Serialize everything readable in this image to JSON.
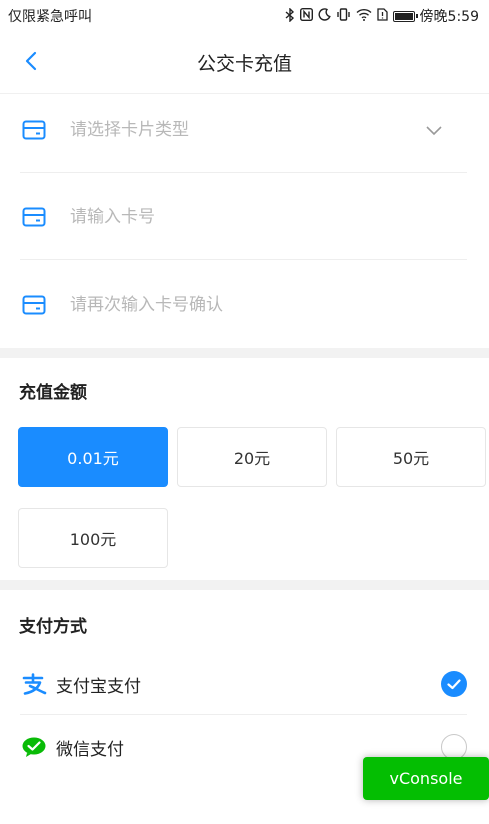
{
  "status_bar": {
    "carrier_text": "仅限紧急呼叫",
    "time": "傍晚5:59"
  },
  "nav": {
    "title": "公交卡充值"
  },
  "card_form": {
    "card_type_placeholder": "请选择卡片类型",
    "card_number_placeholder": "请输入卡号",
    "card_confirm_placeholder": "请再次输入卡号确认"
  },
  "amount_section": {
    "title": "充值金额",
    "options": [
      "0.01元",
      "20元",
      "50元",
      "100元"
    ],
    "selected_index": 0
  },
  "payment_section": {
    "title": "支付方式",
    "methods": [
      {
        "label": "支付宝支付",
        "icon": "alipay-icon",
        "selected": true
      },
      {
        "label": "微信支付",
        "icon": "wechat-icon",
        "selected": false
      }
    ]
  },
  "vconsole": {
    "label": "vConsole"
  },
  "colors": {
    "accent": "#1a8cff",
    "wechat_green": "#09bb07",
    "vconsole_green": "#04be02"
  }
}
